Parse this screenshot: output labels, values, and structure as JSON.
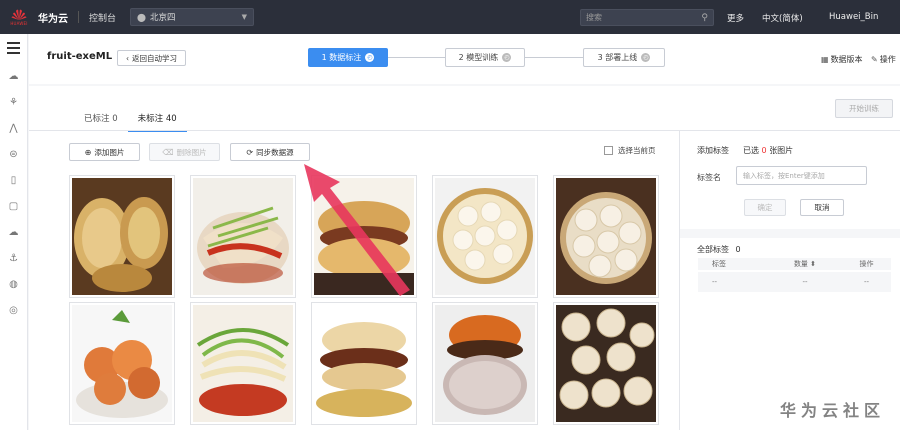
{
  "topbar": {
    "brand": "华为云",
    "logo_text": "HUAWEI",
    "console": "控制台",
    "region": "北京四",
    "search_placeholder": "搜索",
    "more": "更多",
    "language": "中文(简体)",
    "user": "Huawei_Bin"
  },
  "header": {
    "project": "fruit-exeML",
    "back_button": "返回自动学习",
    "steps": [
      {
        "label": "1 数据标注",
        "state": "active"
      },
      {
        "label": "2 模型训练",
        "state": "idle"
      },
      {
        "label": "3 部署上线",
        "state": "idle"
      }
    ],
    "dataset_version": "数据版本",
    "operations": "操作"
  },
  "main": {
    "tabs": [
      {
        "label": "已标注 0"
      },
      {
        "label": "未标注 40"
      }
    ],
    "start_training": "开始训练",
    "toolbar": {
      "add_image": "添加图片",
      "delete_image": "删除图片",
      "sync_source": "同步数据源",
      "select_page": "选择当前页"
    },
    "images": [
      {
        "subject": "烤饼"
      },
      {
        "subject": "凉皮"
      },
      {
        "subject": "肉夹馍"
      },
      {
        "subject": "小笼包"
      },
      {
        "subject": "小笼包"
      },
      {
        "subject": "柿饼"
      },
      {
        "subject": "凉皮"
      },
      {
        "subject": "肉夹馍"
      },
      {
        "subject": "柿饼"
      },
      {
        "subject": "小笼包"
      }
    ]
  },
  "right_panel": {
    "add_label_title": "添加标签",
    "selected_prefix": "已选",
    "selected_count": "0",
    "selected_suffix": "张图片",
    "label_name": "标签名",
    "label_input_placeholder": "输入标签，按Enter键添加",
    "confirm": "确定",
    "cancel": "取消",
    "all_labels_title": "全部标签",
    "all_labels_count": "0",
    "table_headers": [
      "标签",
      "数量",
      "操作"
    ],
    "table_row": [
      "--",
      "--",
      "--"
    ]
  },
  "watermark": "华为云社区",
  "colors": {
    "topbar": "#2b2f3a",
    "accent": "#3b8df0",
    "selected_count": "#e33333",
    "annotation_arrow": "#e8365d"
  }
}
